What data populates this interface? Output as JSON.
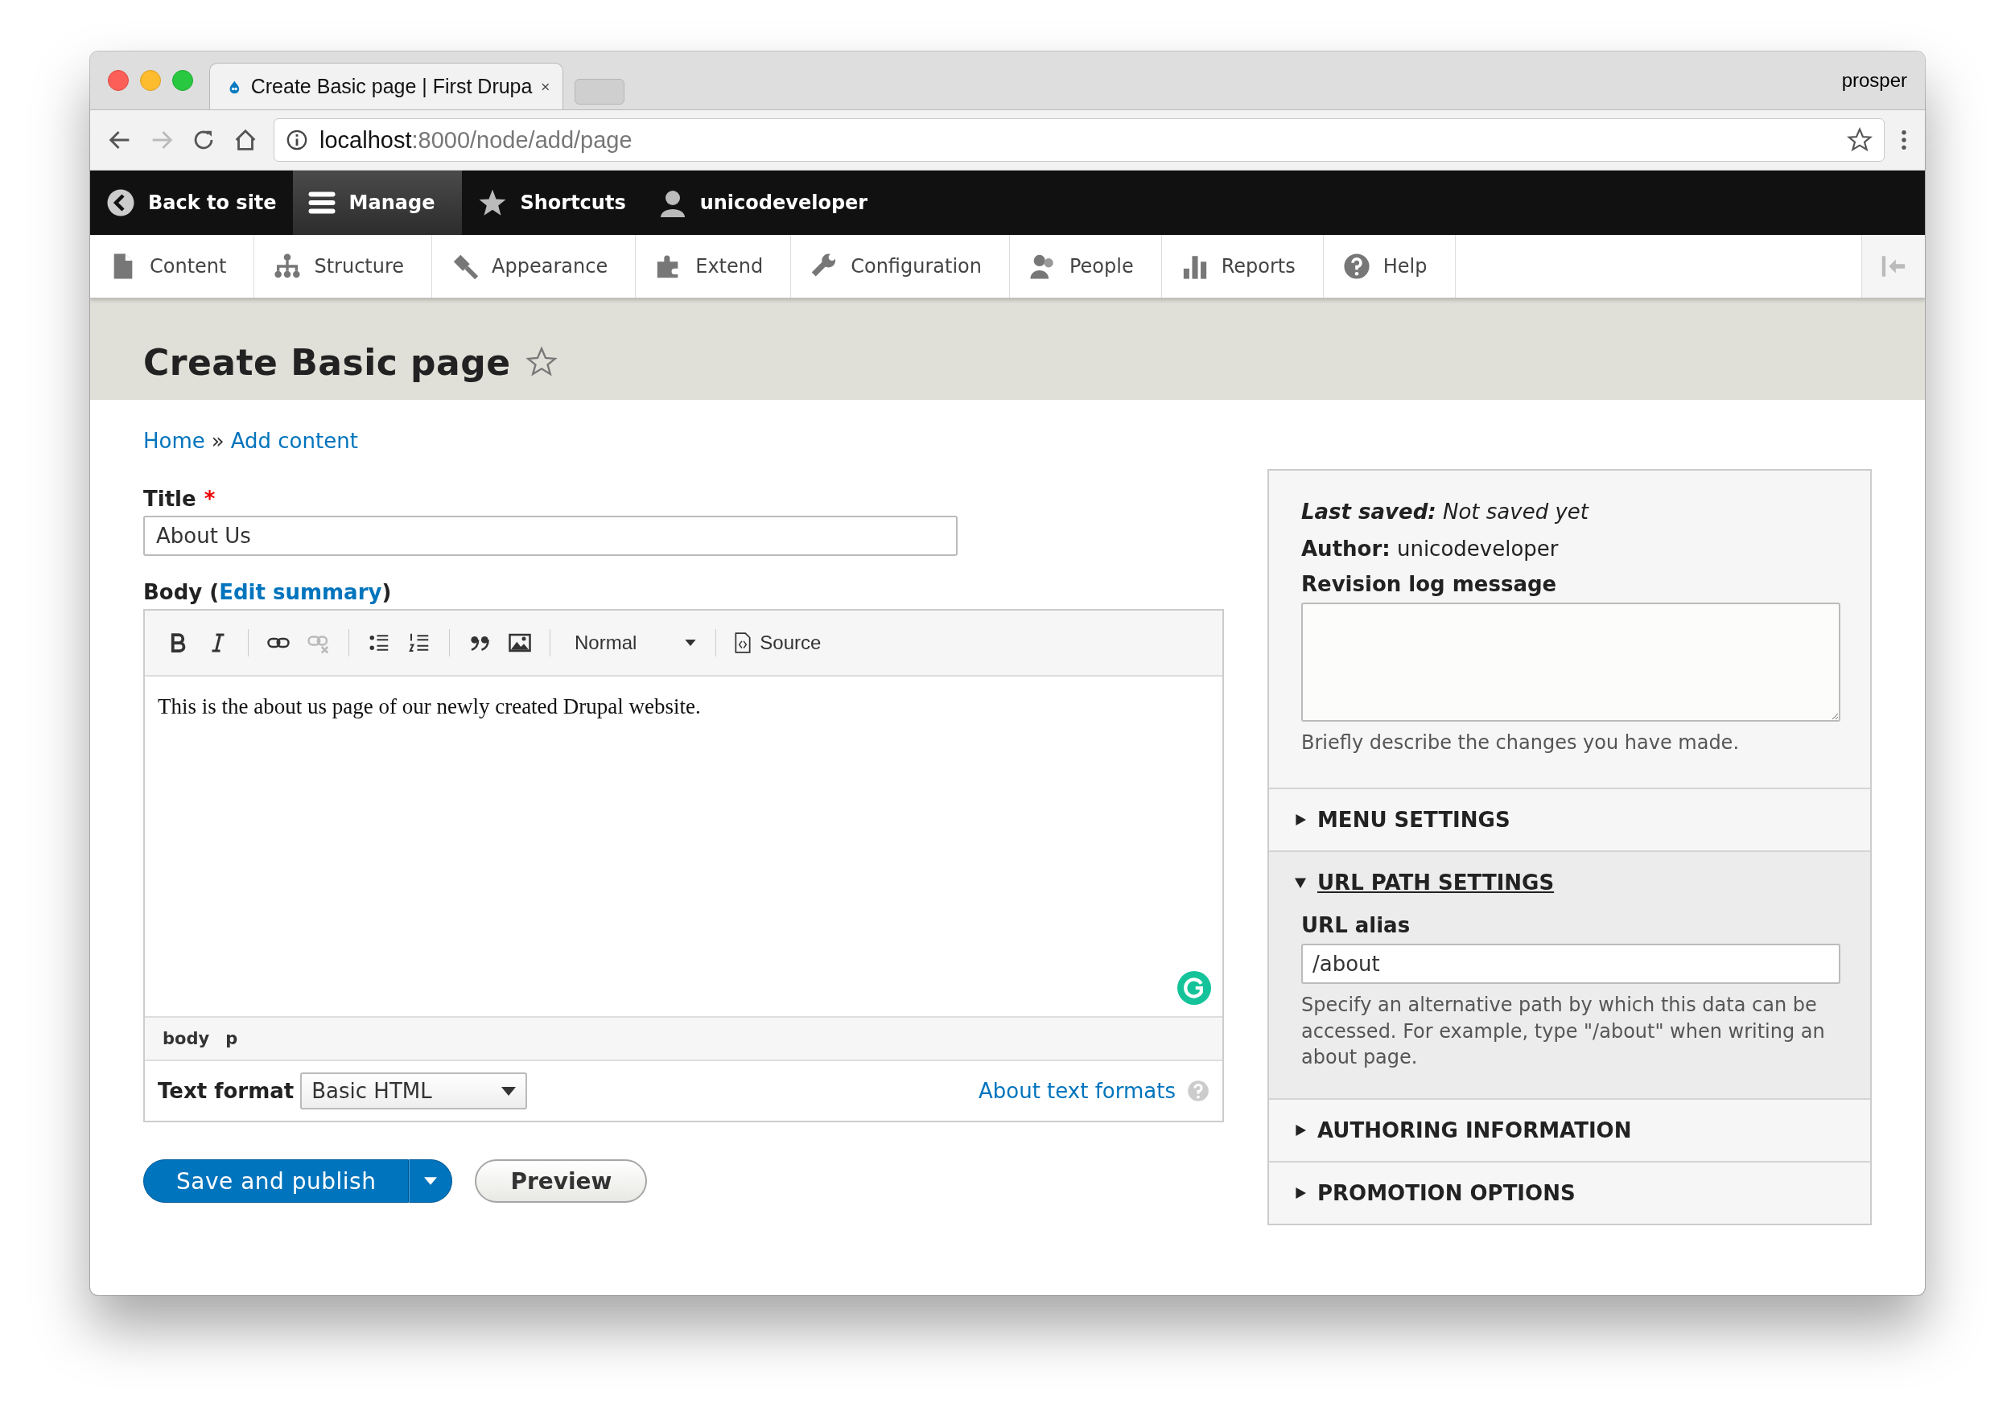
{
  "browser": {
    "tab_title": "Create Basic page | First Drupa",
    "profile": "prosper",
    "url_host": "localhost",
    "url_rest": ":8000/node/add/page"
  },
  "toolbar": [
    {
      "label": "Back to site",
      "kind": "back",
      "selected": false
    },
    {
      "label": "Manage",
      "kind": "manage",
      "selected": true
    },
    {
      "label": "Shortcuts",
      "kind": "shortcuts",
      "selected": false
    },
    {
      "label": "unicodeveloper",
      "kind": "user",
      "selected": false
    }
  ],
  "tray": [
    {
      "label": "Content",
      "kind": "content"
    },
    {
      "label": "Structure",
      "kind": "structure"
    },
    {
      "label": "Appearance",
      "kind": "appearance"
    },
    {
      "label": "Extend",
      "kind": "extend"
    },
    {
      "label": "Configuration",
      "kind": "configuration"
    },
    {
      "label": "People",
      "kind": "people"
    },
    {
      "label": "Reports",
      "kind": "reports"
    },
    {
      "label": "Help",
      "kind": "help"
    }
  ],
  "page_title": "Create Basic page",
  "breadcrumb": {
    "items": [
      "Home",
      "Add content"
    ],
    "separator": "»"
  },
  "title_field": {
    "label": "Title",
    "required_mark": "*",
    "value": "About Us"
  },
  "body_field": {
    "label": "Body (",
    "link": "Edit summary",
    "label_end": ")",
    "tools": [
      {
        "kind": "bold",
        "disabled": false
      },
      {
        "kind": "italic",
        "disabled": false
      },
      {
        "kind": "sep"
      },
      {
        "kind": "link",
        "disabled": false
      },
      {
        "kind": "unlink",
        "disabled": true
      },
      {
        "kind": "sep"
      },
      {
        "kind": "bullets",
        "disabled": false
      },
      {
        "kind": "numbers",
        "disabled": false
      },
      {
        "kind": "sep"
      },
      {
        "kind": "quote",
        "disabled": false
      },
      {
        "kind": "image",
        "disabled": false
      },
      {
        "kind": "sep"
      }
    ],
    "format_select": "Normal",
    "source": "Source",
    "content": "This is the about us page of our newly created Drupal website.",
    "path": [
      "body",
      "p"
    ],
    "text_format_label": "Text format",
    "text_format": "Basic HTML",
    "formats_link": "About text formats"
  },
  "buttons": {
    "primary": "Save and publish",
    "secondary": "Preview"
  },
  "sidebar": {
    "last_saved_label": "Last saved:",
    "last_saved": "Not saved yet",
    "author_label": "Author:",
    "author": "unicodeveloper",
    "revision_label": "Revision log message",
    "revision_hint": "Briefly describe the changes you have made.",
    "sections": [
      {
        "title": "MENU SETTINGS",
        "expanded": false
      },
      {
        "title": "URL PATH SETTINGS",
        "expanded": true,
        "field_label": "URL alias",
        "field_value": "/about",
        "field_hint": "Specify an alternative path by which this data can be accessed. For example, type \"/about\" when writing an about page."
      },
      {
        "title": "AUTHORING INFORMATION",
        "expanded": false
      },
      {
        "title": "PROMOTION OPTIONS",
        "expanded": false
      }
    ]
  }
}
